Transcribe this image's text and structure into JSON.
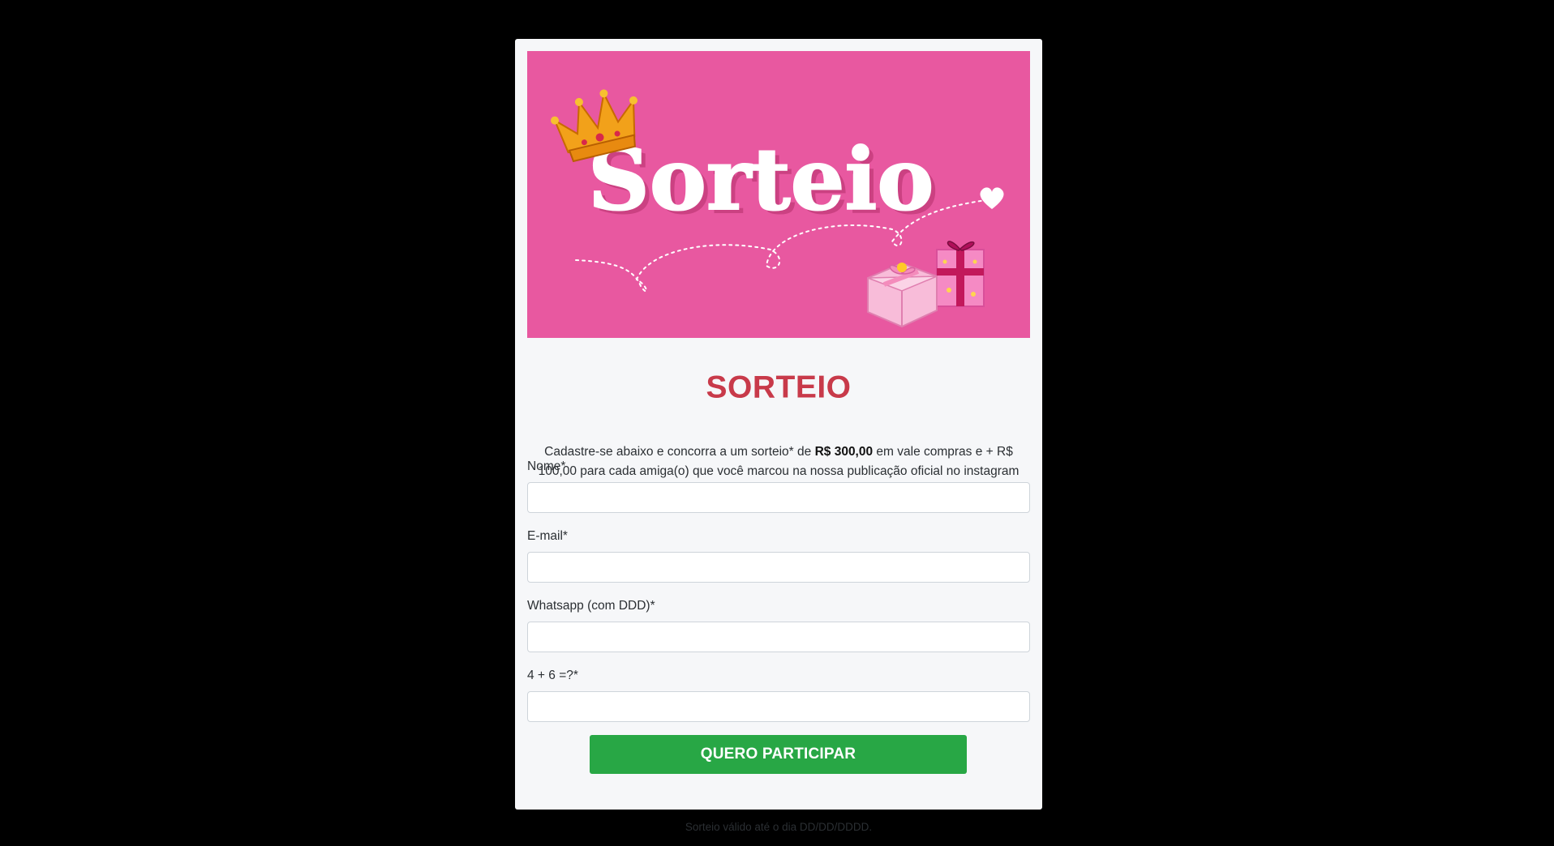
{
  "banner": {
    "logo_text": "Sorteio",
    "background_color": "#e858a0",
    "decorations": [
      "crown-icon",
      "heart-icon",
      "gift-icon"
    ]
  },
  "title": "SORTEIO",
  "description": {
    "part1": "Cadastre-se abaixo e concorra a um sorteio* de ",
    "highlight": "R$ 300,00",
    "part2": " em vale compras e + R$ 100,00 para cada amiga(o) que você marcou na nossa publicação oficial no instagram"
  },
  "form": {
    "fields": [
      {
        "label": "Nome*",
        "value": ""
      },
      {
        "label": "E-mail*",
        "value": ""
      },
      {
        "label": "Whatsapp (com DDD)*",
        "value": ""
      },
      {
        "label": "4 + 6 =?*",
        "value": ""
      }
    ],
    "submit_label": "QUERO PARTICIPAR"
  },
  "footnote": "Sorteio válido até o dia DD/DD/DDDD.",
  "colors": {
    "title": "#c83a4a",
    "button": "#28a745",
    "card": "#f6f7f9",
    "page_background": "#000000"
  }
}
